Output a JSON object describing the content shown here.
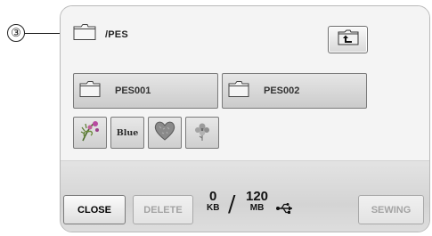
{
  "callout": {
    "number": "③"
  },
  "path": {
    "text": "/PES",
    "icon": "folder-icon"
  },
  "up_button": {
    "icon": "folder-up-arrow-icon"
  },
  "folders": [
    {
      "label": "PES001",
      "icon": "folder-icon"
    },
    {
      "label": "PES002",
      "icon": "folder-icon"
    }
  ],
  "thumbnails": [
    {
      "icon": "floral-design-icon"
    },
    {
      "icon": "text-design-icon",
      "text": "Blue"
    },
    {
      "icon": "heart-design-icon"
    },
    {
      "icon": "flower-design-icon"
    }
  ],
  "footer": {
    "close_label": "CLOSE",
    "delete_label": "DELETE",
    "used_value": "0",
    "used_unit": "KB",
    "slash": "/",
    "total_value": "120",
    "total_unit": "MB",
    "usb_icon": "usb-icon",
    "sewing_label": "SEWING"
  },
  "colors": {
    "disabled_text": "#a3a3a3",
    "panel": "#f4f4f4",
    "footer": "#d8d8d8"
  }
}
